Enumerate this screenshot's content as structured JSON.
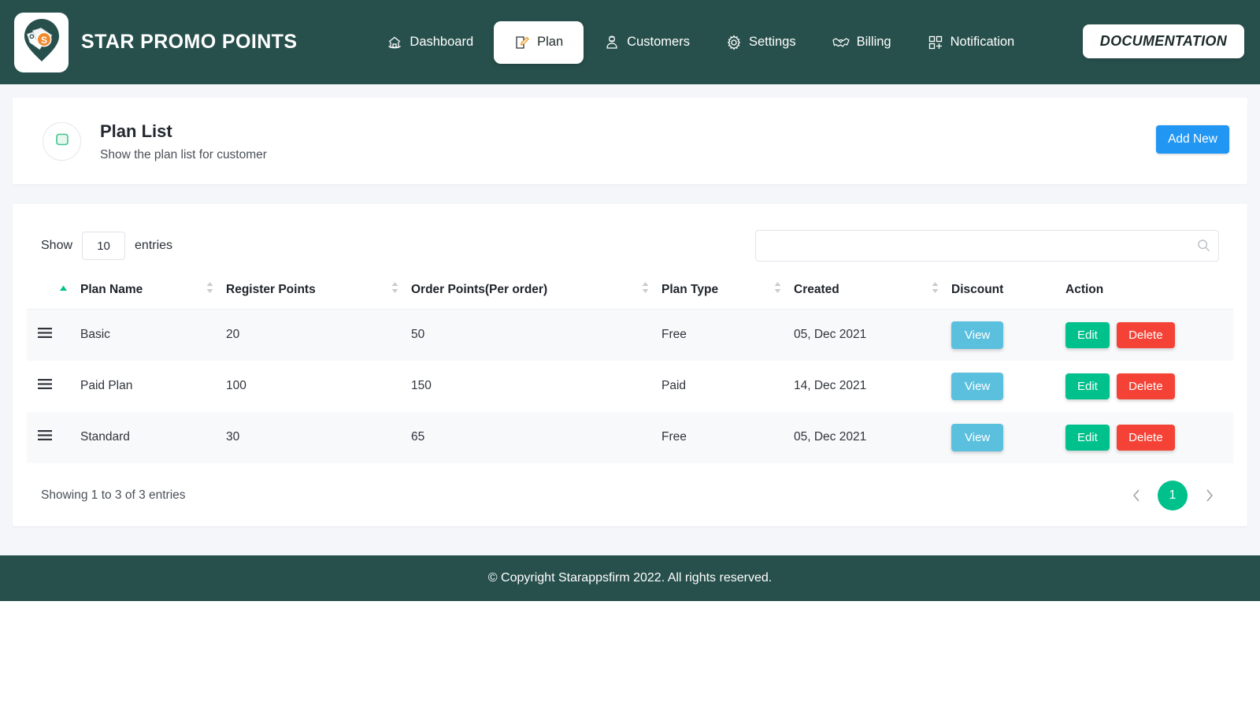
{
  "brand": {
    "name": "STAR PROMO POINTS",
    "logo_icon": "price-tag-pin-dollar-logo"
  },
  "nav": {
    "items": [
      {
        "label": "Dashboard",
        "icon": "dashboard-home-icon",
        "active": false
      },
      {
        "label": "Plan",
        "icon": "edit-square-icon",
        "active": true
      },
      {
        "label": "Customers",
        "icon": "customers-person-icon",
        "active": false
      },
      {
        "label": "Settings",
        "icon": "gear-icon",
        "active": false
      },
      {
        "label": "Billing",
        "icon": "handshake-icon",
        "active": false
      },
      {
        "label": "Notification",
        "icon": "grid-plus-icon",
        "active": false
      }
    ],
    "documentation_label": "DOCUMENTATION"
  },
  "page_header": {
    "icon": "rounded-square-icon",
    "title": "Plan List",
    "subtitle": "Show the plan list for customer",
    "add_new_label": "Add New"
  },
  "toolbar": {
    "show_label": "Show",
    "entries_value": "10",
    "entries_label": "entries",
    "search_value": "",
    "search_placeholder": "",
    "search_icon": "search-icon"
  },
  "table": {
    "columns": [
      {
        "label": "",
        "sortable": false,
        "sort_state": "none"
      },
      {
        "label": "Plan Name",
        "sortable": true,
        "sort_state": "asc"
      },
      {
        "label": "Register Points",
        "sortable": true,
        "sort_state": "none"
      },
      {
        "label": "Order Points(Per order)",
        "sortable": true,
        "sort_state": "none"
      },
      {
        "label": "Plan Type",
        "sortable": true,
        "sort_state": "none"
      },
      {
        "label": "Created",
        "sortable": true,
        "sort_state": "none"
      },
      {
        "label": "Discount",
        "sortable": false,
        "sort_state": "none"
      },
      {
        "label": "Action",
        "sortable": false,
        "sort_state": "none"
      }
    ],
    "rows": [
      {
        "handle_icon": "drag-handle-icon",
        "plan_name": "Basic",
        "register_points": "20",
        "order_points": "50",
        "plan_type": "Free",
        "created": "05, Dec 2021",
        "discount_label": "View",
        "edit_label": "Edit",
        "delete_label": "Delete"
      },
      {
        "handle_icon": "drag-handle-icon",
        "plan_name": "Paid Plan",
        "register_points": "100",
        "order_points": "150",
        "plan_type": "Paid",
        "created": "14, Dec 2021",
        "discount_label": "View",
        "edit_label": "Edit",
        "delete_label": "Delete"
      },
      {
        "handle_icon": "drag-handle-icon",
        "plan_name": "Standard",
        "register_points": "30",
        "order_points": "65",
        "plan_type": "Free",
        "created": "05, Dec 2021",
        "discount_label": "View",
        "edit_label": "Edit",
        "delete_label": "Delete"
      }
    ],
    "showing_text": "Showing 1 to 3 of 3 entries",
    "pagination": {
      "prev_icon": "chevron-left-icon",
      "next_icon": "chevron-right-icon",
      "current_page": "1"
    }
  },
  "footer": {
    "copyright": "© Copyright Starappsfirm 2022. All rights reserved."
  },
  "colors": {
    "brand_dark": "#27504c",
    "accent_blue": "#2196f3",
    "accent_green": "#00c08b",
    "accent_red": "#f44336",
    "accent_lightblue": "#5bc0de",
    "page_bg": "#f4f6f9"
  }
}
